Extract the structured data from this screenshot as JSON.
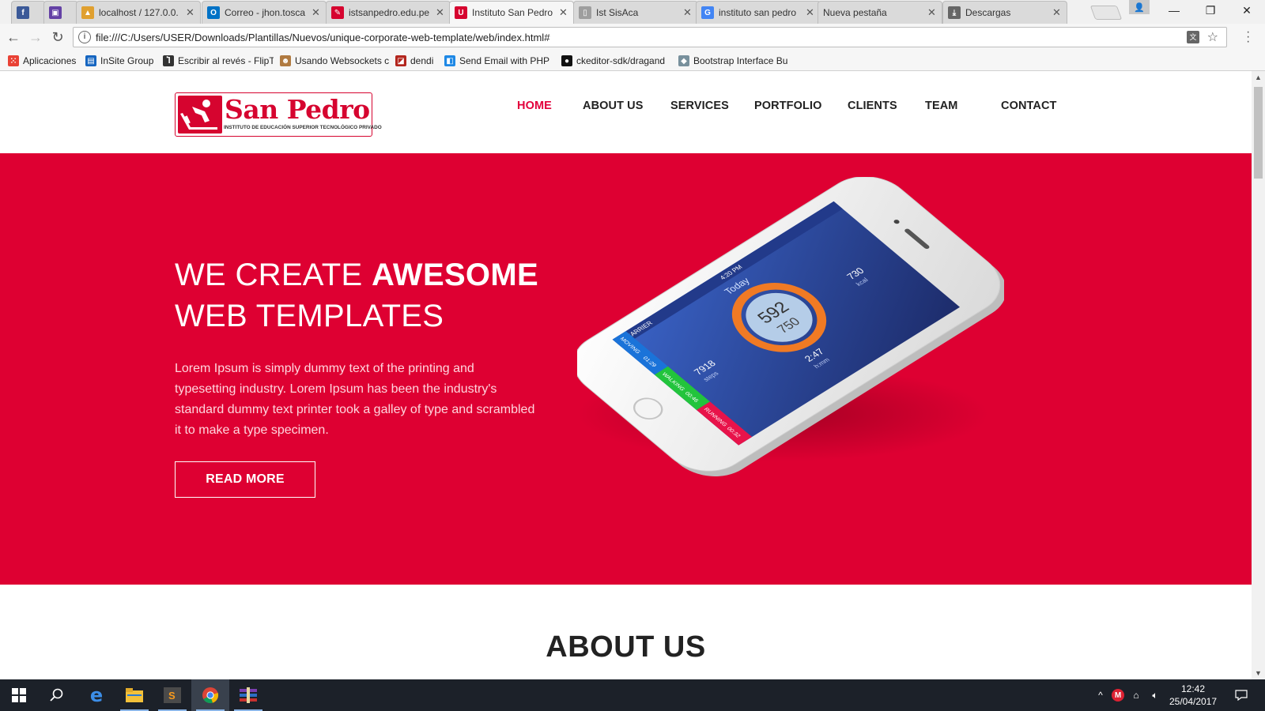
{
  "browser": {
    "tabs": [
      {
        "label": "",
        "icon": "facebook-icon",
        "color": "#3b5998",
        "glyph": "f"
      },
      {
        "label": "",
        "icon": "twitch-icon",
        "color": "#6441a5",
        "glyph": "▣"
      },
      {
        "label": "localhost / 127.0.0.",
        "icon": "phpmyadmin-icon",
        "color": "#e0a030",
        "glyph": "▲"
      },
      {
        "label": "Correo - jhon.tosca",
        "icon": "outlook-icon",
        "color": "#0072c6",
        "glyph": "O"
      },
      {
        "label": "istsanpedro.edu.pe",
        "icon": "site-icon",
        "color": "#d6042f",
        "glyph": "✎"
      },
      {
        "label": "Instituto San Pedro",
        "icon": "unique-icon",
        "color": "#d6042f",
        "glyph": "U",
        "active": true
      },
      {
        "label": "Ist SisAca",
        "icon": "page-icon",
        "color": "#9e9e9e",
        "glyph": "▯"
      },
      {
        "label": "instituto san pedro",
        "icon": "google-icon",
        "color": "#4285f4",
        "glyph": "G"
      },
      {
        "label": "Nueva pestaña",
        "icon": "",
        "color": "",
        "glyph": ""
      },
      {
        "label": "Descargas",
        "icon": "download-icon",
        "color": "#666666",
        "glyph": "⤓"
      }
    ],
    "url": "file:///C:/Users/USER/Downloads/Plantillas/Nuevos/unique-corporate-web-template/web/index.html#",
    "bookmarks": [
      {
        "label": "Aplicaciones",
        "icon": "apps-grid-icon",
        "color": "#e94235",
        "glyph": "⁙"
      },
      {
        "label": "InSite Group",
        "icon": "insite-icon",
        "color": "#1565c0",
        "glyph": "▤"
      },
      {
        "label": "Escribir al revés - FlipT",
        "icon": "flip-icon",
        "color": "#333333",
        "glyph": "Ⴈ"
      },
      {
        "label": "Usando Websockets c",
        "icon": "avatar-icon",
        "color": "#b07a40",
        "glyph": "☻"
      },
      {
        "label": "dendi",
        "icon": "dota-icon",
        "color": "#b3261e",
        "glyph": "◪"
      },
      {
        "label": "Send Email with PHP",
        "icon": "email-icon",
        "color": "#1e88e5",
        "glyph": "◧"
      },
      {
        "label": "ckeditor-sdk/dragand",
        "icon": "github-icon",
        "color": "#111111",
        "glyph": "●"
      },
      {
        "label": "Bootstrap Interface Bu",
        "icon": "cube-icon",
        "color": "#78909c",
        "glyph": "◆"
      }
    ]
  },
  "site": {
    "logo": {
      "name": "San Pedro",
      "subtitle": "INSTITUTO DE EDUCACIÓN SUPERIOR TECNOLÓGICO PRIVADO"
    },
    "nav": [
      "HOME",
      "ABOUT US",
      "SERVICES",
      "PORTFOLIO",
      "CLIENTS",
      "TEAM",
      "CONTACT"
    ],
    "active_nav": "HOME",
    "hero": {
      "title_light": "WE CREATE ",
      "title_bold": "AWESOME",
      "title_line2": "WEB TEMPLATES",
      "text": "Lorem Ipsum is simply dummy text of the printing and typesetting industry. Lorem Ipsum has been the industry's standard dummy text printer took a galley of type and scrambled it to make a type specimen.",
      "button": "READ MORE"
    },
    "phone_screen": {
      "carrier": "CARRIER",
      "time": "4:20 PM",
      "heading": "Today",
      "value_main": "592",
      "value_goal": "750",
      "stats": [
        {
          "value": "7918",
          "unit": "steps"
        },
        {
          "value": "2:47",
          "unit": "h:mm"
        },
        {
          "value": "730",
          "unit": "kcal"
        }
      ],
      "activities": [
        {
          "label": "MOVING",
          "time": "01:29",
          "color": "#1a73d9"
        },
        {
          "label": "WALKING",
          "time": "00:46",
          "color": "#22c43c"
        },
        {
          "label": "RUNNING",
          "time": "00:32",
          "color": "#e8134a"
        }
      ]
    },
    "about_title": "ABOUT US",
    "colors": {
      "brand": "#de0032",
      "nav_active": "#e2003b"
    }
  },
  "taskbar": {
    "clock_time": "12:42",
    "clock_date": "25/04/2017"
  }
}
